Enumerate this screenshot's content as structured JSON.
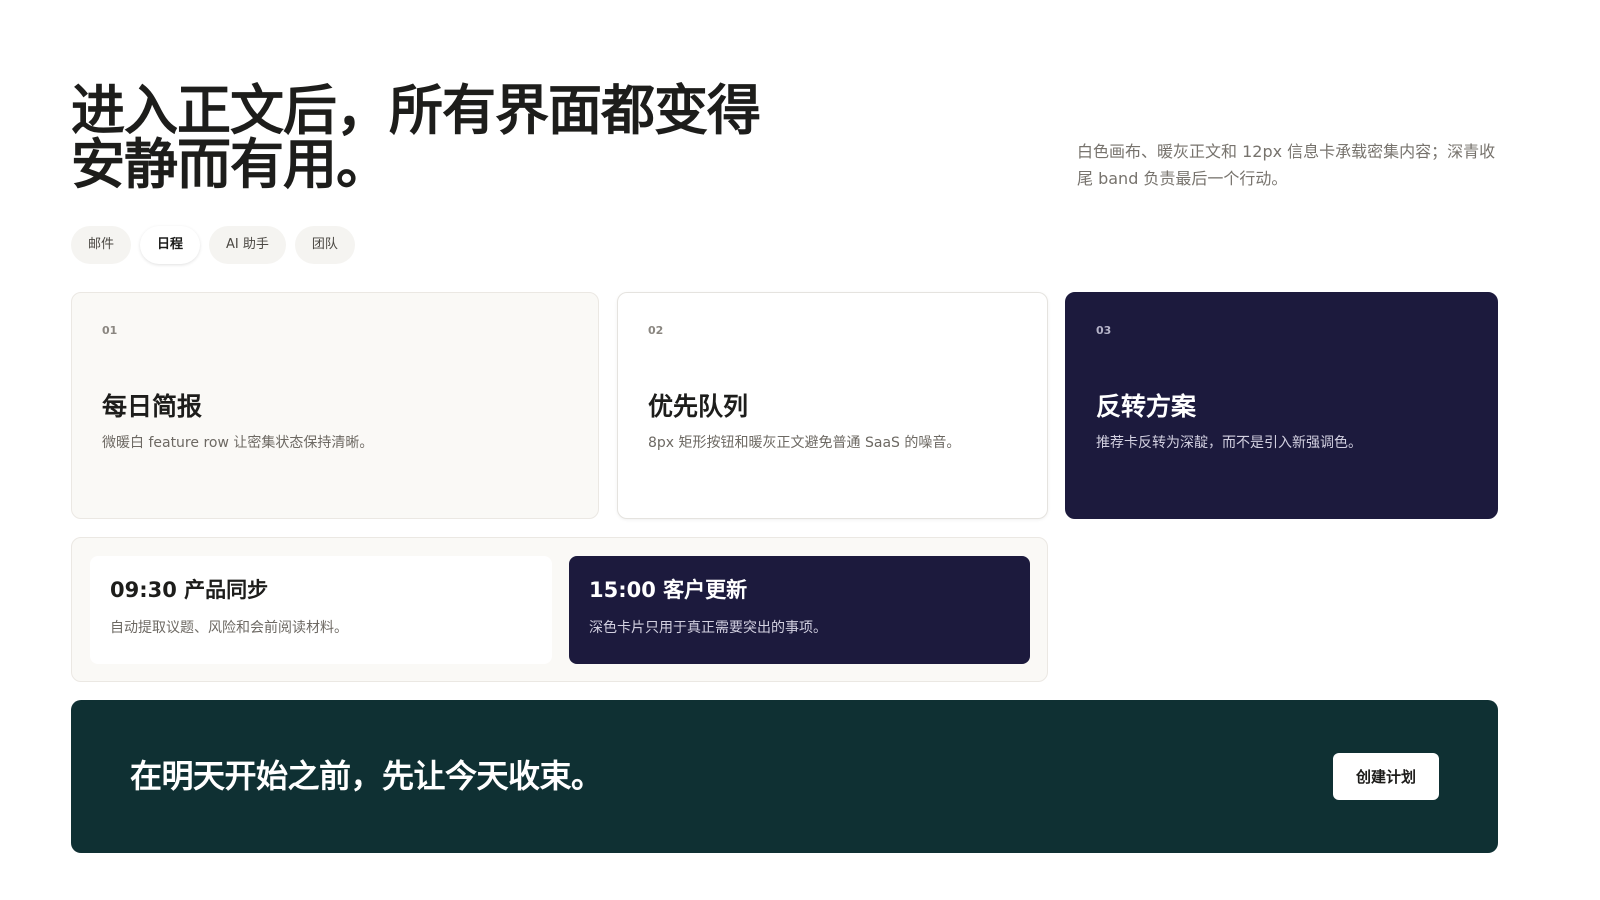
{
  "hero": {
    "title_line1": "进入正文后，所有界面都变得",
    "title_line2": "安静而有用。",
    "description": "白色画布、暖灰正文和 12px 信息卡承载密集内容；深青收尾 band 负责最后一个行动。"
  },
  "tabs": [
    {
      "label": "邮件",
      "active": false
    },
    {
      "label": "日程",
      "active": true
    },
    {
      "label": "AI 助手",
      "active": false
    },
    {
      "label": "团队",
      "active": false
    }
  ],
  "cards": [
    {
      "number": "01",
      "title": "每日简报",
      "description": "微暖白 feature row 让密集状态保持清晰。"
    },
    {
      "number": "02",
      "title": "优先队列",
      "description": "8px 矩形按钮和暖灰正文避免普通 SaaS 的噪音。"
    },
    {
      "number": "03",
      "title": "反转方案",
      "description": "推荐卡反转为深靛，而不是引入新强调色。"
    }
  ],
  "schedule": [
    {
      "title": "09:30 产品同步",
      "description": "自动提取议题、风险和会前阅读材料。"
    },
    {
      "title": "15:00 客户更新",
      "description": "深色卡片只用于真正需要突出的事项。"
    }
  ],
  "band": {
    "title": "在明天开始之前，先让今天收束。",
    "button_label": "创建计划"
  },
  "colors": {
    "indigo": "#1c1a3d",
    "deep_teal": "#0f3033",
    "warm_white": "#faf9f6"
  }
}
